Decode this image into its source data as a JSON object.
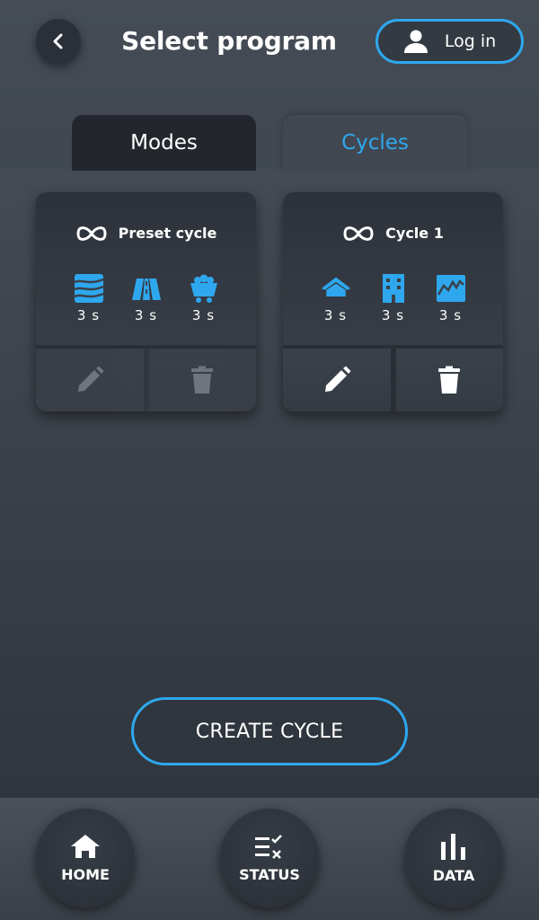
{
  "header": {
    "title": "Select program",
    "back_icon": "chevron-left-icon",
    "login": {
      "label": "Log in",
      "icon": "user-icon"
    }
  },
  "tabs": [
    {
      "label": "Modes",
      "active": false
    },
    {
      "label": "Cycles",
      "active": true
    }
  ],
  "cycles": [
    {
      "title": "Preset cycle",
      "icon": "infinity-icon",
      "editable": false,
      "steps": [
        {
          "icon": "waves-icon",
          "duration": "3 s"
        },
        {
          "icon": "road-icon",
          "duration": "3 s"
        },
        {
          "icon": "mine-cart-icon",
          "duration": "3 s"
        }
      ],
      "actions": [
        "edit-icon",
        "delete-icon"
      ]
    },
    {
      "title": "Cycle 1",
      "icon": "infinity-icon",
      "editable": true,
      "steps": [
        {
          "icon": "house-icon",
          "duration": "3 s"
        },
        {
          "icon": "building-icon",
          "duration": "3 s"
        },
        {
          "icon": "chart-area-icon",
          "duration": "3 s"
        }
      ],
      "actions": [
        "edit-icon",
        "delete-icon"
      ]
    }
  ],
  "create_button": {
    "label": "CREATE CYCLE"
  },
  "bottom_nav": [
    {
      "label": "HOME",
      "icon": "home-icon"
    },
    {
      "label": "STATUS",
      "icon": "checklist-icon"
    },
    {
      "label": "DATA",
      "icon": "bar-chart-icon"
    }
  ],
  "colors": {
    "accent": "#2ea7ee",
    "background": "#3c434c",
    "active_tab_dark": "#23272d"
  }
}
